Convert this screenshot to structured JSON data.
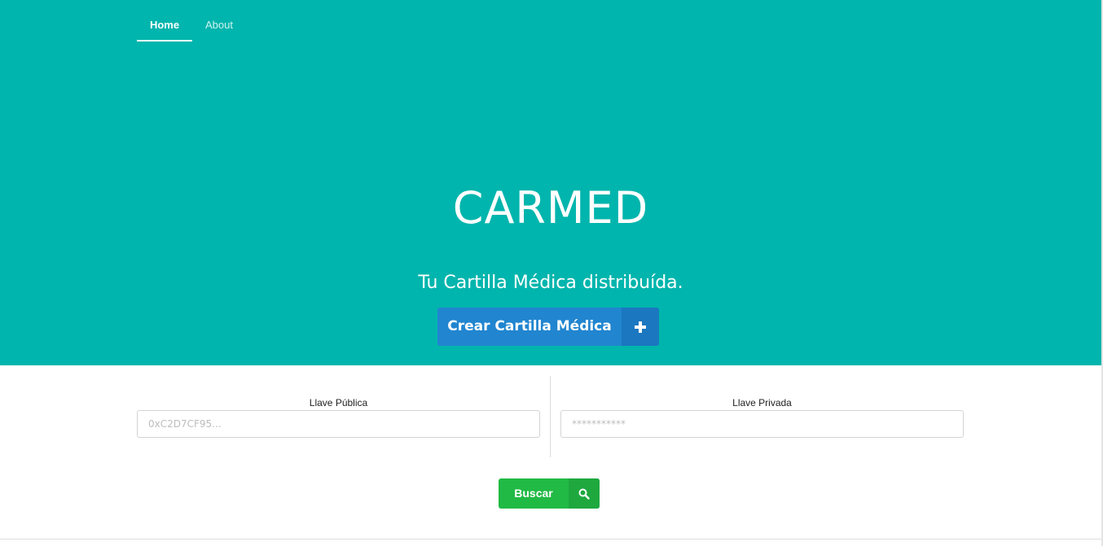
{
  "nav": {
    "items": [
      {
        "label": "Home",
        "active": true
      },
      {
        "label": "About",
        "active": false
      }
    ]
  },
  "hero": {
    "title": "CARMED",
    "subtitle": "Tu Cartilla Médica distribuída.",
    "create_button": {
      "label": "Crear Cartilla Médica",
      "icon": "plus-icon"
    }
  },
  "form": {
    "public_key": {
      "label": "Llave Pública",
      "placeholder": "0xC2D7CF95...",
      "value": ""
    },
    "private_key": {
      "label": "Llave Privada",
      "placeholder": "***********",
      "value": ""
    },
    "search_button": {
      "label": "Buscar",
      "icon": "search-icon"
    }
  },
  "colors": {
    "hero_bg": "#00b5ad",
    "primary_blue": "#2185d0",
    "success_green": "#21ba45"
  }
}
